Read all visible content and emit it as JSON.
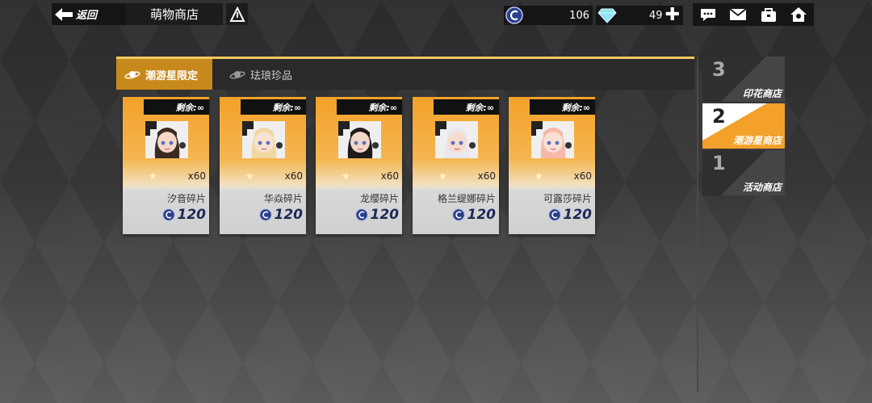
{
  "header": {
    "back_label": "返回",
    "title": "萌物商店",
    "coins": "106",
    "gems": "49"
  },
  "tabs": [
    {
      "label": "潮游星限定",
      "active": true
    },
    {
      "label": "珐琅珍品",
      "active": false
    }
  ],
  "items": [
    {
      "name": "汐音碎片",
      "remaining": "剩余:∞",
      "quantity": "x60",
      "price": "120",
      "hair": "#3a2a22",
      "skin": "#f5d8c8"
    },
    {
      "name": "华焱碎片",
      "remaining": "剩余:∞",
      "quantity": "x60",
      "price": "120",
      "hair": "#f0d8a0",
      "skin": "#f8e2d0"
    },
    {
      "name": "龙缨碎片",
      "remaining": "剩余:∞",
      "quantity": "x60",
      "price": "120",
      "hair": "#1e1a1a",
      "skin": "#f2d6c8"
    },
    {
      "name": "格兰缇娜碎片",
      "remaining": "剩余:∞",
      "quantity": "x60",
      "price": "120",
      "hair": "#e8e8ee",
      "skin": "#f6dcd0"
    },
    {
      "name": "可露莎碎片",
      "remaining": "剩余:∞",
      "quantity": "x60",
      "price": "120",
      "hair": "#f6b8a8",
      "skin": "#fae0d4"
    }
  ],
  "side_nav": [
    {
      "number": "3",
      "label": "印花商店",
      "active": false
    },
    {
      "number": "2",
      "label": "潮游星商店",
      "active": true
    },
    {
      "number": "1",
      "label": "活动商店",
      "active": false
    }
  ],
  "colors": {
    "accent": "#f3a12a",
    "tab_active": "#c8891c",
    "border_gold": "#f0c860"
  }
}
